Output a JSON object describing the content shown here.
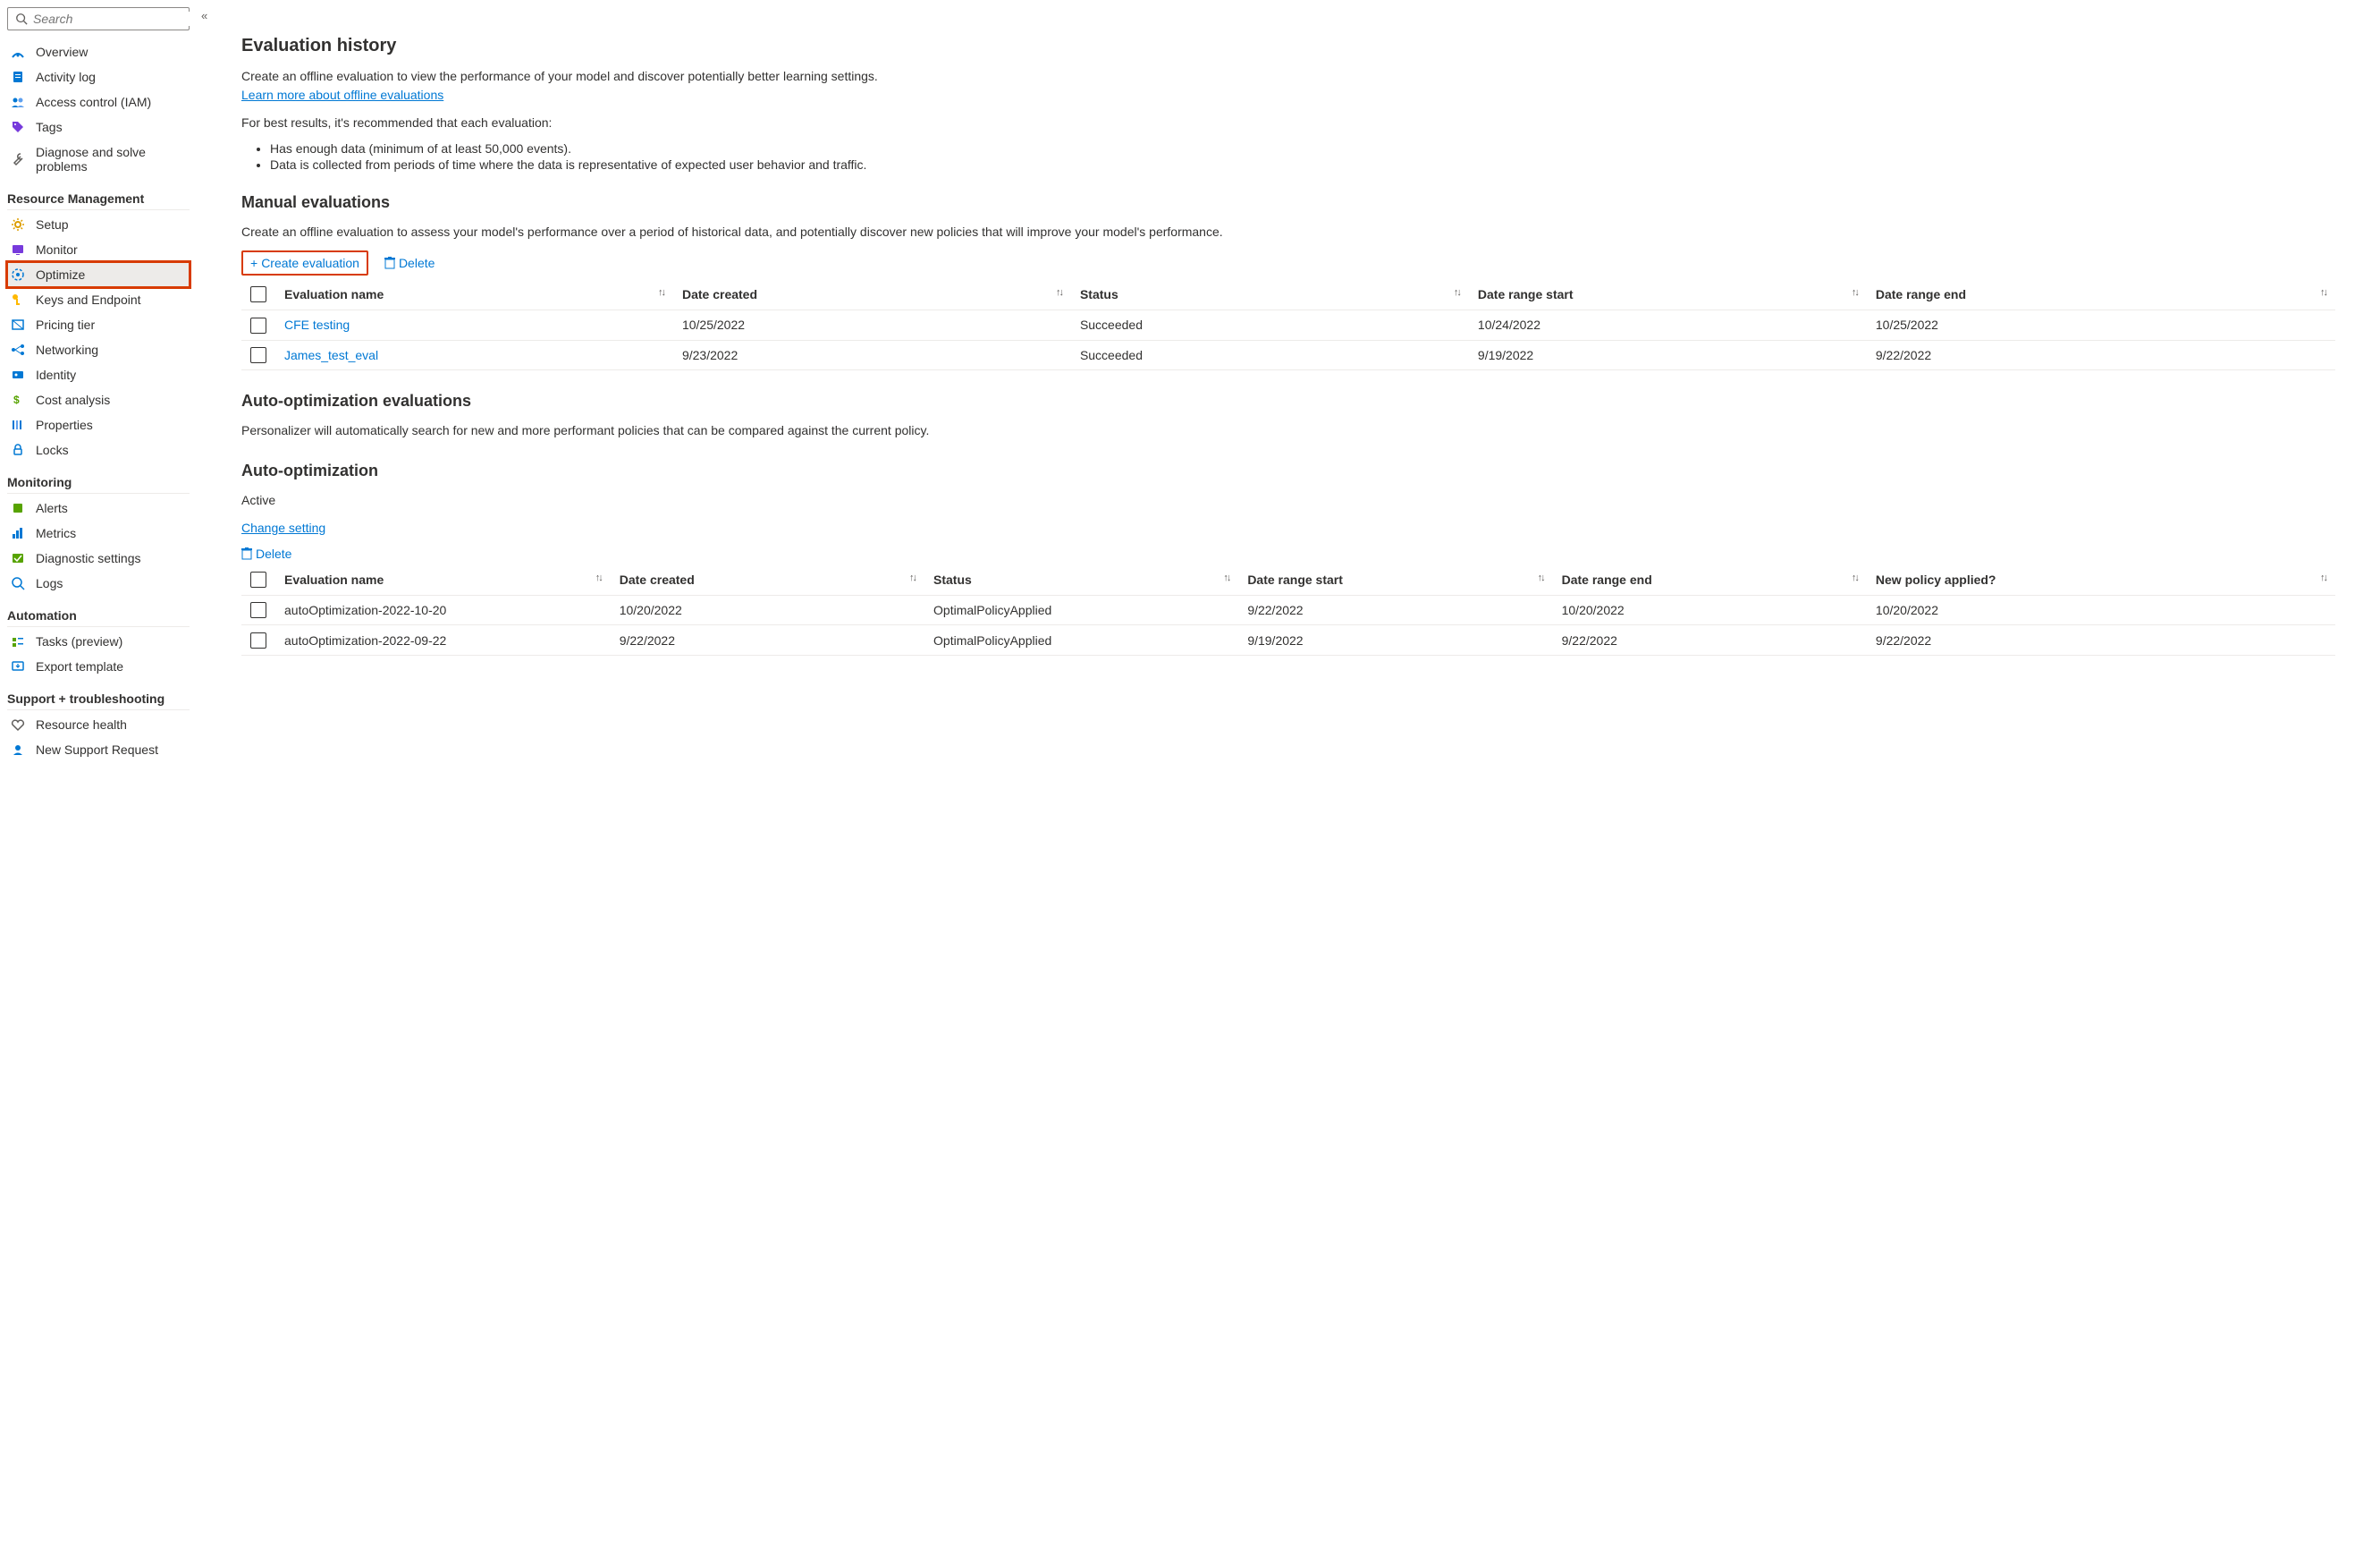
{
  "search": {
    "placeholder": "Search"
  },
  "sidebar": {
    "primary": [
      {
        "label": "Overview",
        "icon": "radar"
      },
      {
        "label": "Activity log",
        "icon": "log"
      },
      {
        "label": "Access control (IAM)",
        "icon": "people"
      },
      {
        "label": "Tags",
        "icon": "tag"
      },
      {
        "label": "Diagnose and solve problems",
        "icon": "wrench"
      }
    ],
    "sections": [
      {
        "header": "Resource Management",
        "items": [
          {
            "label": "Setup",
            "icon": "gear"
          },
          {
            "label": "Monitor",
            "icon": "monitor"
          },
          {
            "label": "Optimize",
            "icon": "optimize",
            "active": true
          },
          {
            "label": "Keys and Endpoint",
            "icon": "key"
          },
          {
            "label": "Pricing tier",
            "icon": "pricing"
          },
          {
            "label": "Networking",
            "icon": "network"
          },
          {
            "label": "Identity",
            "icon": "identity"
          },
          {
            "label": "Cost analysis",
            "icon": "cost"
          },
          {
            "label": "Properties",
            "icon": "properties"
          },
          {
            "label": "Locks",
            "icon": "lock"
          }
        ]
      },
      {
        "header": "Monitoring",
        "items": [
          {
            "label": "Alerts",
            "icon": "alerts"
          },
          {
            "label": "Metrics",
            "icon": "metrics"
          },
          {
            "label": "Diagnostic settings",
            "icon": "diag"
          },
          {
            "label": "Logs",
            "icon": "logs"
          }
        ]
      },
      {
        "header": "Automation",
        "items": [
          {
            "label": "Tasks (preview)",
            "icon": "tasks"
          },
          {
            "label": "Export template",
            "icon": "export"
          }
        ]
      },
      {
        "header": "Support + troubleshooting",
        "items": [
          {
            "label": "Resource health",
            "icon": "heart"
          },
          {
            "label": "New Support Request",
            "icon": "support"
          }
        ]
      }
    ]
  },
  "page": {
    "title": "Evaluation history",
    "intro": "Create an offline evaluation to view the performance of your model and discover potentially better learning settings.",
    "learn_more": "Learn more about offline evaluations",
    "tips_intro": "For best results, it's recommended that each evaluation:",
    "tips": [
      "Has enough data (minimum of at least 50,000 events).",
      "Data is collected from periods of time where the data is representative of expected user behavior and traffic."
    ],
    "manual": {
      "heading": "Manual evaluations",
      "desc": "Create an offline evaluation to assess your model's performance over a period of historical data, and potentially discover new policies that will improve your model's performance.",
      "create_label": "Create evaluation",
      "delete_label": "Delete",
      "columns": [
        "Evaluation name",
        "Date created",
        "Status",
        "Date range start",
        "Date range end"
      ],
      "rows": [
        {
          "name": "CFE testing",
          "created": "10/25/2022",
          "status": "Succeeded",
          "start": "10/24/2022",
          "end": "10/25/2022"
        },
        {
          "name": "James_test_eval",
          "created": "9/23/2022",
          "status": "Succeeded",
          "start": "9/19/2022",
          "end": "9/22/2022"
        }
      ]
    },
    "auto_eval": {
      "heading": "Auto-optimization evaluations",
      "desc": "Personalizer will automatically search for new and more performant policies that can be compared against the current policy."
    },
    "auto_opt": {
      "heading": "Auto-optimization",
      "status": "Active",
      "change_link": "Change setting",
      "delete_label": "Delete",
      "columns": [
        "Evaluation name",
        "Date created",
        "Status",
        "Date range start",
        "Date range end",
        "New policy applied?"
      ],
      "rows": [
        {
          "name": "autoOptimization-2022-10-20",
          "created": "10/20/2022",
          "status": "OptimalPolicyApplied",
          "start": "9/22/2022",
          "end": "10/20/2022",
          "applied": "10/20/2022"
        },
        {
          "name": "autoOptimization-2022-09-22",
          "created": "9/22/2022",
          "status": "OptimalPolicyApplied",
          "start": "9/19/2022",
          "end": "9/22/2022",
          "applied": "9/22/2022"
        }
      ]
    }
  }
}
